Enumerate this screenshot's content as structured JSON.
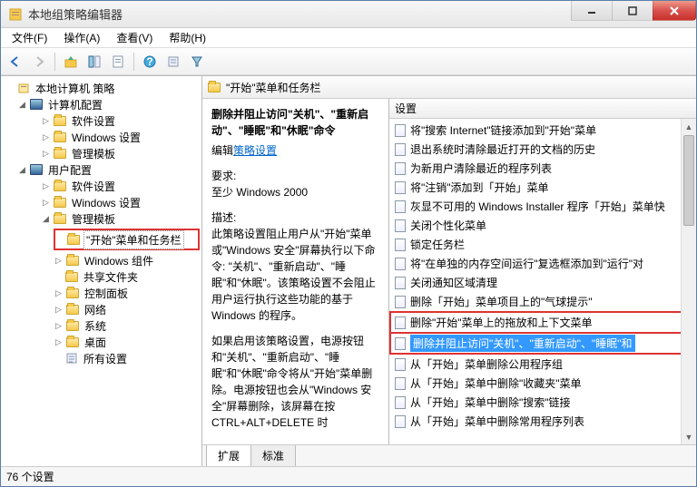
{
  "window": {
    "title": "本地组策略编辑器"
  },
  "menu": {
    "file": "文件(F)",
    "action": "操作(A)",
    "view": "查看(V)",
    "help": "帮助(H)"
  },
  "tree": {
    "root": "本地计算机 策略",
    "comp_cfg": "计算机配置",
    "comp_soft": "软件设置",
    "comp_win": "Windows 设置",
    "comp_admin": "管理模板",
    "user_cfg": "用户配置",
    "user_soft": "软件设置",
    "user_win": "Windows 设置",
    "user_admin": "管理模板",
    "start_taskbar": "\"开始\"菜单和任务栏",
    "win_comp": "Windows 组件",
    "shared": "共享文件夹",
    "ctrl": "控制面板",
    "net": "网络",
    "sys": "系统",
    "desk": "桌面",
    "all": "所有设置"
  },
  "path": "\"开始\"菜单和任务栏",
  "desc": {
    "heading": "删除并阻止访问\"关机\"、\"重新启动\"、\"睡眠\"和\"休眠\"命令",
    "editlink_pre": "编辑",
    "editlink": "策略设置",
    "req_label": "要求:",
    "req_val": "至少 Windows 2000",
    "desc_label": "描述:",
    "p1": "此策略设置阻止用户从\"开始\"菜单或\"Windows 安全\"屏幕执行以下命令: \"关机\"、\"重新启动\"、\"睡眠\"和\"休眠\"。该策略设置不会阻止用户运行执行这些功能的基于 Windows 的程序。",
    "p2": "如果启用该策略设置，电源按钮和\"关机\"、\"重新启动\"、\"睡眠\"和\"休眠\"命令将从\"开始\"菜单删除。电源按钮也会从\"Windows 安全\"屏幕删除，该屏幕在按 CTRL+ALT+DELETE 时"
  },
  "list": {
    "header": "设置",
    "items": [
      "将\"搜索 Internet\"链接添加到\"开始\"菜单",
      "退出系统时清除最近打开的文档的历史",
      "为新用户清除最近的程序列表",
      "将\"注销\"添加到「开始」菜单",
      "灰显不可用的 Windows Installer 程序「开始」菜单快",
      "关闭个性化菜单",
      "锁定任务栏",
      "将\"在单独的内存空间运行\"复选框添加到\"运行\"对",
      "关闭通知区域清理",
      "删除「开始」菜单项目上的\"气球提示\"",
      "删除\"开始\"菜单上的拖放和上下文菜单",
      "删除并阻止访问\"关机\"、\"重新启动\"、\"睡眠\"和",
      "从「开始」菜单删除公用程序组",
      "从「开始」菜单中删除\"收藏夹\"菜单",
      "从「开始」菜单中删除\"搜索\"链接",
      "从「开始」菜单中删除常用程序列表"
    ],
    "hl_index": 11,
    "hl2_index": 10
  },
  "tabs": {
    "extended": "扩展",
    "standard": "标准"
  },
  "status": "76 个设置"
}
